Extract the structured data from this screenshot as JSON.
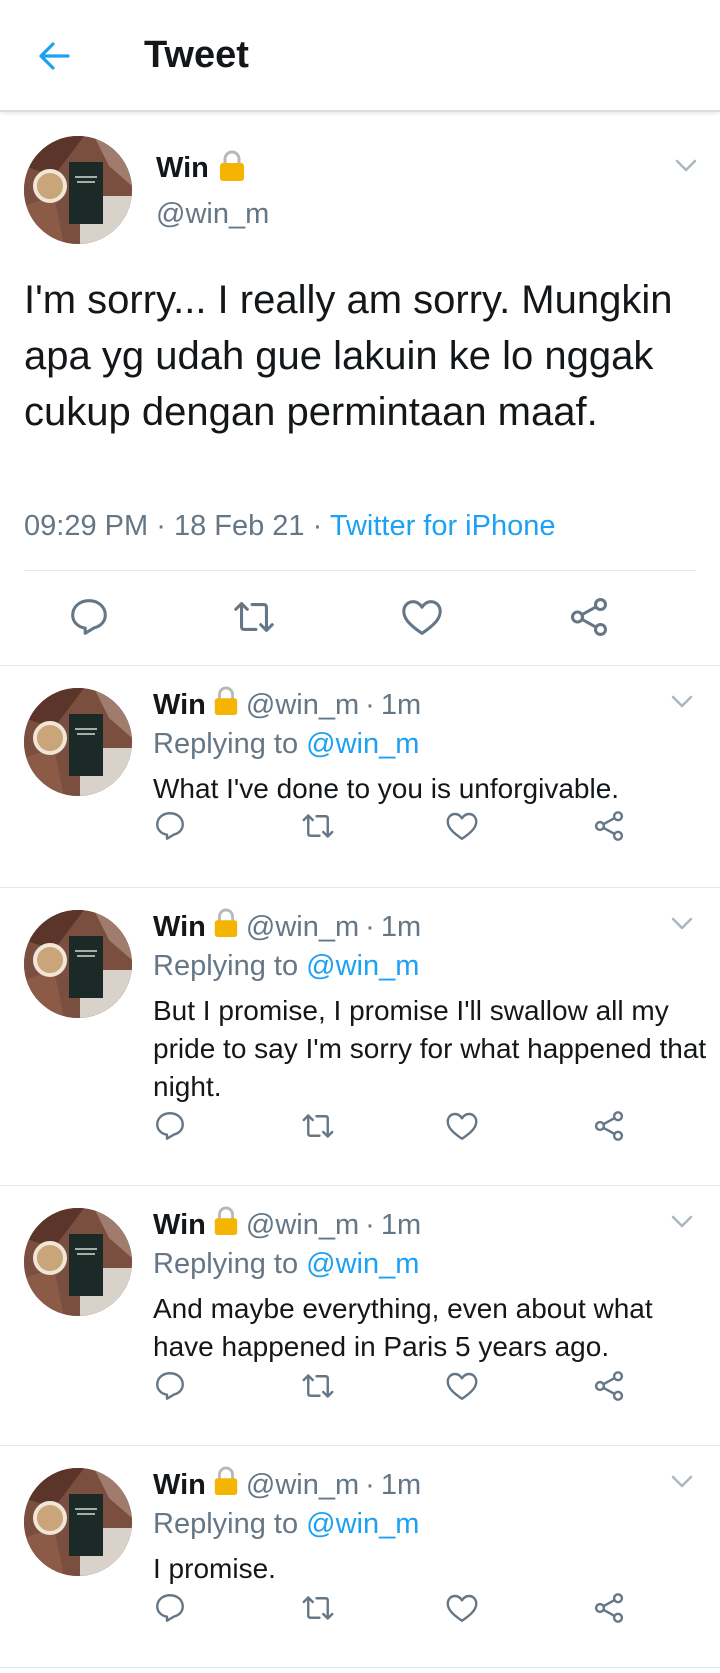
{
  "header": {
    "title": "Tweet",
    "back_icon": "arrow-left-icon"
  },
  "colors": {
    "accent": "#1da1f2",
    "muted": "#657786",
    "text": "#14171a",
    "lock": "#f5b400"
  },
  "main_tweet": {
    "name": "Win",
    "handle": "@win_m",
    "text": "I'm sorry... I really am sorry. Mungkin apa yg udah gue lakuin ke lo nggak cukup dengan permintaan maaf.",
    "time": "09:29 PM",
    "date": "18 Feb 21",
    "source": "Twitter for iPhone",
    "sep": "·"
  },
  "replies": [
    {
      "name": "Win",
      "handle": "@win_m",
      "sep": "·",
      "time": "1m",
      "replying_prefix": "Replying to",
      "replying_to": "@win_m",
      "text": "What I've done to you is unforgivable."
    },
    {
      "name": "Win",
      "handle": "@win_m",
      "sep": "·",
      "time": "1m",
      "replying_prefix": "Replying to",
      "replying_to": "@win_m",
      "text": "But I promise, I promise I'll swallow all my pride to say I'm sorry for what happened that night."
    },
    {
      "name": "Win",
      "handle": "@win_m",
      "sep": "·",
      "time": "1m",
      "replying_prefix": "Replying to",
      "replying_to": "@win_m",
      "text": "And maybe everything, even about what have happened in Paris 5 years ago."
    },
    {
      "name": "Win",
      "handle": "@win_m",
      "sep": "·",
      "time": "1m",
      "replying_prefix": "Replying to",
      "replying_to": "@win_m",
      "text": "I promise."
    }
  ],
  "icons": [
    "arrow-left-icon",
    "lock-icon",
    "chevron-down-icon",
    "reply-icon",
    "retweet-icon",
    "like-icon",
    "share-icon"
  ]
}
